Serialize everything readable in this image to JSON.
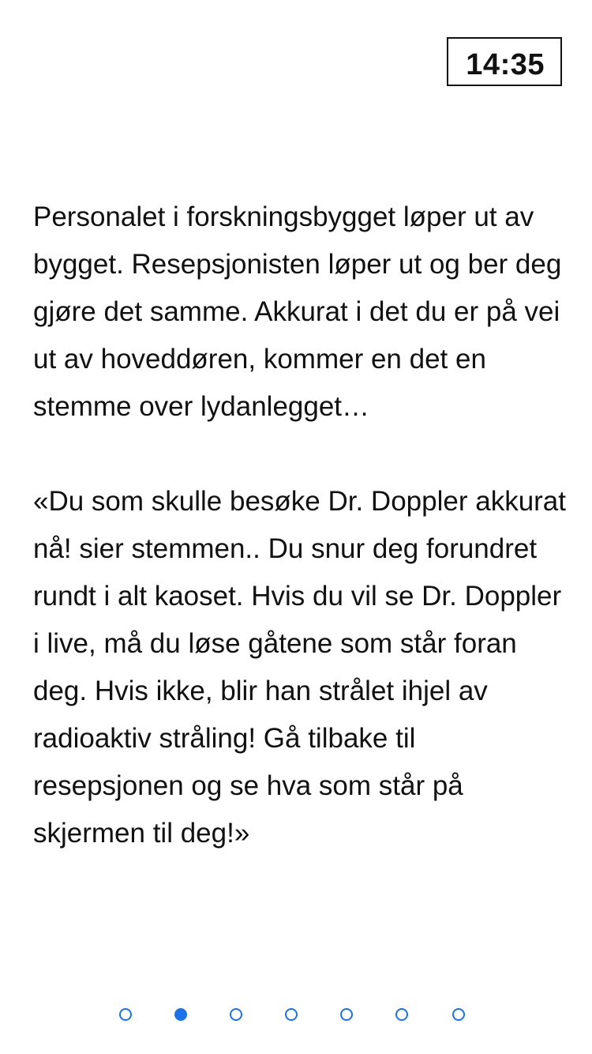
{
  "timer": {
    "value": "14:35"
  },
  "story": {
    "paragraphs": [
      "Personalet i forskningsbygget løper ut av bygget. Resepsjonisten løper ut og ber deg gjøre det samme. Akkurat i det du er på vei ut av hoveddøren, kommer en det en stemme over lydanlegget…",
      "«Du som skulle besøke Dr. Doppler akkurat nå! sier stemmen.. Du snur deg forundret rundt i alt kaoset. Hvis du vil se Dr. Doppler i live, må du løse gåtene som står foran deg. Hvis ikke, blir han strålet ihjel av radioaktiv stråling! Gå tilbake til resepsjonen og se hva som står på skjermen til deg!»"
    ]
  },
  "pager": {
    "count": 7,
    "active_index": 1,
    "accent_color": "#1a73e8"
  }
}
